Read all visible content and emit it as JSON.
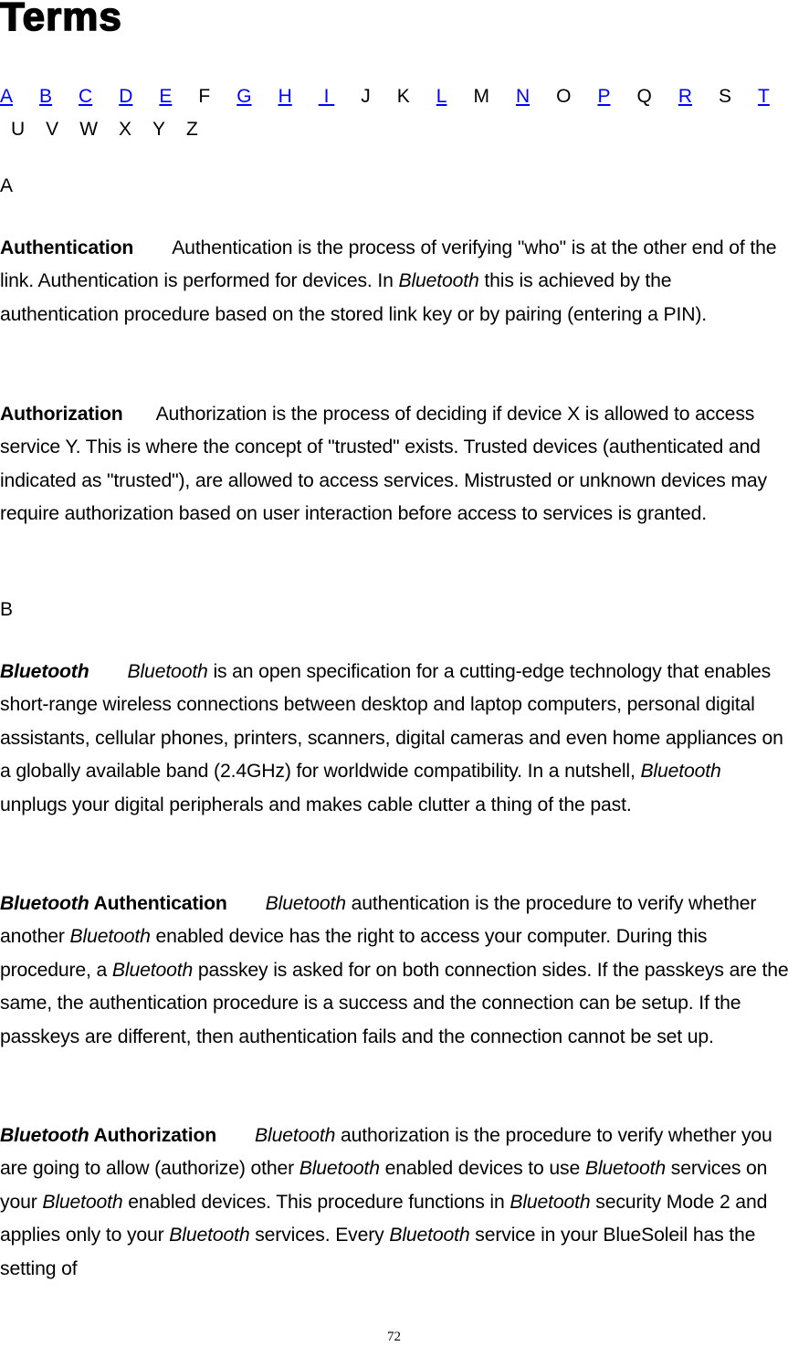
{
  "page": {
    "title": "Terms",
    "page_number": "72"
  },
  "alphabet_nav": {
    "link_color": "#0000ff",
    "rows": [
      [
        {
          "letter": "A",
          "link": true
        },
        {
          "letter": "B",
          "link": true
        },
        {
          "letter": "C",
          "link": true
        },
        {
          "letter": "D",
          "link": true
        },
        {
          "letter": "E",
          "link": true
        },
        {
          "letter": "F",
          "link": false
        },
        {
          "letter": "G",
          "link": true
        },
        {
          "letter": "H",
          "link": true
        },
        {
          "letter": " I ",
          "link": true
        },
        {
          "letter": "J",
          "link": false
        },
        {
          "letter": "K",
          "link": false
        },
        {
          "letter": "L",
          "link": true
        },
        {
          "letter": "M",
          "link": false
        },
        {
          "letter": "N",
          "link": true
        },
        {
          "letter": "O",
          "link": false
        },
        {
          "letter": "P",
          "link": true
        },
        {
          "letter": "Q",
          "link": false
        },
        {
          "letter": "R",
          "link": true
        },
        {
          "letter": "S",
          "link": false
        },
        {
          "letter": "T",
          "link": true
        }
      ],
      [
        {
          "letter": "U",
          "link": false
        },
        {
          "letter": "V",
          "link": false
        },
        {
          "letter": "W",
          "link": false
        },
        {
          "letter": "X",
          "link": false
        },
        {
          "letter": "Y",
          "link": false
        },
        {
          "letter": "Z",
          "link": false
        }
      ]
    ]
  },
  "sections": {
    "a": {
      "heading": "A",
      "authentication": {
        "term": "Authentication",
        "segments": [
          {
            "text": "Authentication is the process of verifying \"who\" is at the other end of the link. Authentication is performed for devices. In ",
            "italic": false
          },
          {
            "text": "Bluetooth",
            "italic": true
          },
          {
            "text": " this is achieved by the authentication procedure based on the stored link key or by pairing (entering a PIN).",
            "italic": false
          }
        ]
      },
      "authorization": {
        "term": "Authorization",
        "segments": [
          {
            "text": "Authorization is the process of deciding if device X is allowed to access service Y. This is where the concept of \"trusted\" exists. Trusted devices (authenticated and indicated as \"trusted\"), are allowed to access services. Mistrusted or unknown devices may require authorization based on user interaction before access to services is granted.",
            "italic": false
          }
        ]
      }
    },
    "b": {
      "heading": "B",
      "bluetooth": {
        "term_italic": "Bluetooth",
        "term_plain": "",
        "segments": [
          {
            "text": "Bluetooth",
            "italic": true
          },
          {
            "text": " is an open specification for a cutting-edge technology that enables short-range wireless connections between desktop and laptop computers, personal digital assistants, cellular phones, printers, scanners, digital cameras and even home appliances on a globally available band (2.4GHz) for worldwide compatibility. In a nutshell, ",
            "italic": false
          },
          {
            "text": "Bluetooth",
            "italic": true
          },
          {
            "text": " unplugs your digital peripherals and makes cable clutter a thing of the past.",
            "italic": false
          }
        ]
      },
      "bluetooth_authentication": {
        "term_italic": "Bluetooth",
        "term_plain": " Authentication",
        "segments": [
          {
            "text": "Bluetooth",
            "italic": true
          },
          {
            "text": " authentication is the procedure to verify whether another ",
            "italic": false
          },
          {
            "text": "Bluetooth",
            "italic": true
          },
          {
            "text": " enabled device has the right to access your computer. During this procedure, a ",
            "italic": false
          },
          {
            "text": "Bluetooth",
            "italic": true
          },
          {
            "text": " passkey is asked for on both connection sides. If the passkeys are the same, the authentication procedure is a success and the connection can be setup. If the passkeys are different, then authentication fails and the connection cannot be set up.",
            "italic": false
          }
        ]
      },
      "bluetooth_authorization": {
        "term_italic": "Bluetooth",
        "term_plain": " Authorization",
        "segments": [
          {
            "text": "Bluetooth",
            "italic": true
          },
          {
            "text": " authorization is the procedure to verify whether you are going to allow (authorize) other ",
            "italic": false
          },
          {
            "text": "Bluetooth",
            "italic": true
          },
          {
            "text": " enabled devices to use ",
            "italic": false
          },
          {
            "text": "Bluetooth",
            "italic": true
          },
          {
            "text": " services on your ",
            "italic": false
          },
          {
            "text": "Bluetooth",
            "italic": true
          },
          {
            "text": " enabled devices. This procedure functions in ",
            "italic": false
          },
          {
            "text": "Bluetooth",
            "italic": true
          },
          {
            "text": " security Mode 2 and applies only to your ",
            "italic": false
          },
          {
            "text": "Bluetooth",
            "italic": true
          },
          {
            "text": " services. Every ",
            "italic": false
          },
          {
            "text": "Bluetooth",
            "italic": true
          },
          {
            "text": " service in your BlueSoleil has the setting of",
            "italic": false
          }
        ]
      }
    }
  }
}
